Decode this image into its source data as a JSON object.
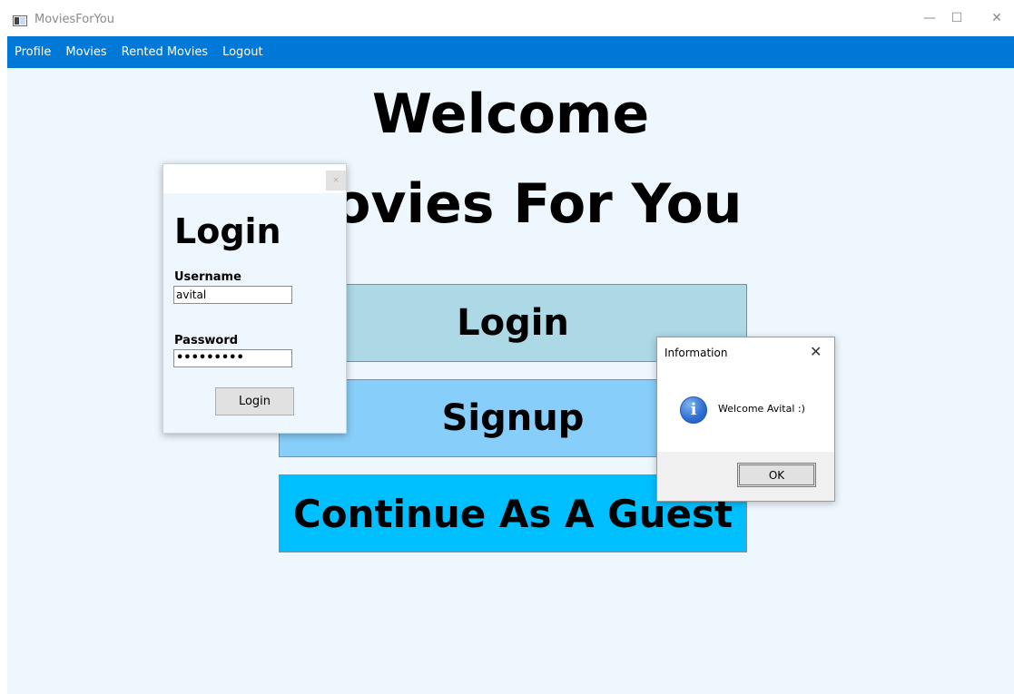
{
  "window": {
    "title": "MoviesForYou",
    "icon": "app-window-icon",
    "controls": {
      "minimize": "—",
      "maximize": "☐",
      "close": "✕"
    }
  },
  "menu": {
    "items": [
      "Profile",
      "Movies",
      "Rented Movies",
      "Logout"
    ]
  },
  "main": {
    "welcome_line1": "Welcome",
    "welcome_line2": "Movies For You",
    "buttons": {
      "login": "Login",
      "signup": "Signup",
      "guest": "Continue As A Guest"
    },
    "button_colors": {
      "login": "#add8e6",
      "signup": "#87cefa",
      "guest": "#00bfff"
    }
  },
  "login_dialog": {
    "heading": "Login",
    "close_glyph": "×",
    "username_label": "Username",
    "username_value": "avital",
    "password_label": "Password",
    "password_value": "•••••••••",
    "submit_label": "Login"
  },
  "info_dialog": {
    "title": "Information",
    "close_glyph": "✕",
    "icon": "info-icon",
    "icon_glyph": "i",
    "message": "Welcome Avital :)",
    "ok_label": "OK"
  },
  "colors": {
    "menubar": "#0078d7",
    "content_bg": "#eff7fe"
  }
}
